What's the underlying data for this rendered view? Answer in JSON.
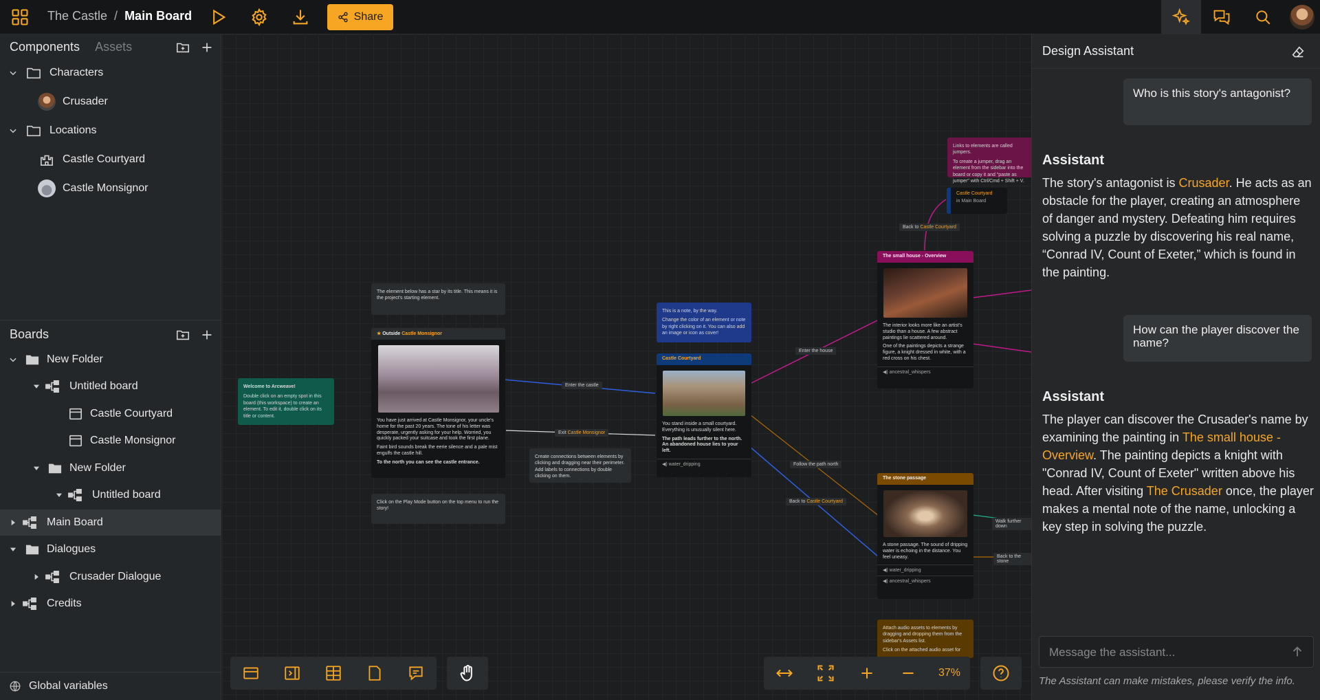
{
  "topbar": {
    "workspace": "The Castle",
    "separator": "/",
    "board": "Main Board",
    "share_label": "Share"
  },
  "sidebar": {
    "components_tab": "Components",
    "assets_tab": "Assets",
    "components": [
      {
        "label": "Characters",
        "type": "folder"
      },
      {
        "label": "Crusader",
        "type": "character"
      },
      {
        "label": "Locations",
        "type": "folder"
      },
      {
        "label": "Castle Courtyard",
        "type": "location"
      },
      {
        "label": "Castle Monsignor",
        "type": "location"
      }
    ],
    "boards_title": "Boards",
    "boards": [
      {
        "label": "New Folder"
      },
      {
        "label": "Untitled board"
      },
      {
        "label": "Castle Courtyard"
      },
      {
        "label": "Castle Monsignor"
      },
      {
        "label": "New Folder"
      },
      {
        "label": "Untitled board"
      },
      {
        "label": "Main Board"
      },
      {
        "label": "Dialogues"
      },
      {
        "label": "Crusader Dialogue"
      },
      {
        "label": "Credits"
      }
    ],
    "global_variables": "Global variables"
  },
  "canvas": {
    "note_star": "The element below has a star by its title. This means it is the project's starting element.",
    "outside_title_a": "Outside",
    "outside_title_b": "Castle Monsignor",
    "outside_text1": "You have just arrived at Castle Monsignor, your uncle's home for the past 20 years. The tone of his letter was desperate, urgently asking for your help. Worried, you quickly packed your suitcase and took the first plane.",
    "outside_text2": "Faint bird sounds break the eerie silence and a pale mist engulfs the castle hill.",
    "outside_text3": "To the north you can see the castle entrance.",
    "note_play": "Click on the Play Mode button on the top menu to run the story!",
    "welcome_title": "Welcome to Arcweave!",
    "welcome_text": "Double click on an empty spot in this board (this workspace) to create an element. To edit it, double click on its title or content.",
    "note_blue1": "This is a note, by the way.",
    "note_blue2": "Change the color of an element or note by right clicking on it. You can also add an image or icon as cover!",
    "courtyard_title": "Castle Courtyard",
    "courtyard_text1": "You stand inside a small courtyard. Everything is unusually silent here.",
    "courtyard_text2": "The path leads further to the north. An abandoned house lies to your left.",
    "courtyard_audio": "water_dripping",
    "note_connections": "Create connections between elements by clicking and dragging near their perimeter. Add labels to connections by double clicking on them.",
    "label_enter_castle": "Enter the castle",
    "label_exit_a": "Exit",
    "label_exit_b": "Castle Monsignor",
    "label_enter_house": "Enter the house",
    "label_follow_path": "Follow the path north",
    "label_back_a": "Back to",
    "label_back_b": "Castle Courtyard",
    "label_back2_a": "Back to",
    "label_back2_b": "Castle Courtyard",
    "label_walk": "Walk further down",
    "label_back_stone": "Back to the stone",
    "note_jumpers1": "Links to elements are called jumpers.",
    "note_jumpers2": "To create a jumper, drag an element from the sidebar into the board or copy it and \"paste as jumper\" with Ctrl/Cmd + Shift + V.",
    "jumper_title": "Castle Courtyard",
    "jumper_sub": "in Main Board",
    "house_title": "The small house - Overview",
    "house_text1": "The interior looks more like an artist's studio than a house. A few abstract paintings lie scattered around.",
    "house_text2": "One of the paintings depicts a strange figure, a knight dressed in white, with a red cross on his chest.",
    "house_audio": "ancestral_whispers",
    "stone_title": "The stone passage",
    "stone_text": "A stone passage. The sound of dripping water is echoing in the distance. You feel uneasy.",
    "stone_audio1": "water_dripping",
    "stone_audio2": "ancestral_whispers",
    "note_audio1": "Attach audio assets to elements by dragging and dropping them from the sidebar's Assets list.",
    "note_audio2": "Click on the attached audio asset for"
  },
  "toolbar": {
    "zoom": "37%"
  },
  "assistant": {
    "title": "Design Assistant",
    "q1": "Who is this story's antagonist?",
    "a1_head": "Assistant",
    "a1_pre": "The story's antagonist is ",
    "a1_link": "Crusader",
    "a1_post": ". He acts as an obstacle for the player, creating an atmosphere of danger and mystery. Defeating him requires solving a puzzle by discovering his real name, “Conrad IV, Count of Exeter,” which is found in the painting.",
    "q2": "How can the player discover the name?",
    "a2_head": "Assistant",
    "a2_pre": "The player can discover the Crusader's name by examining the painting in ",
    "a2_link1": "The small house - Overview",
    "a2_mid": ". The painting depicts a knight with \"Conrad IV, Count of Exeter\" written above his head. After visiting ",
    "a2_link2": "The Crusader",
    "a2_post": " once, the player makes a mental note of the name, unlocking a key step in solving the puzzle.",
    "input_placeholder": "Message the assistant...",
    "disclaimer": "The Assistant can make mistakes, please verify the info."
  },
  "colors": {
    "accent": "#f6a623",
    "note_teal": "#0f5a4b",
    "note_blue": "#1f3a8a",
    "note_magenta": "#6b1448",
    "node_magenta": "#8a0f5a",
    "node_blue": "#0f3a7a",
    "node_amber": "#7a4a00"
  }
}
